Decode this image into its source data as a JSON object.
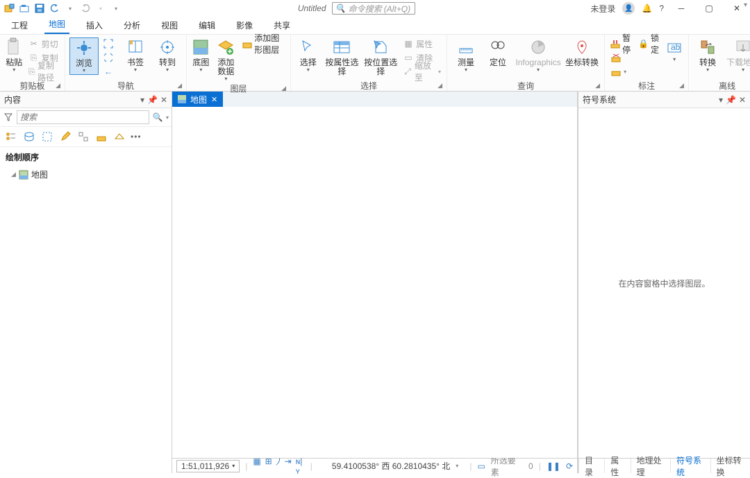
{
  "title": "Untitled",
  "search_placeholder": "命令搜索 (Alt+Q)",
  "login_status": "未登录",
  "ribbon_tabs": [
    "工程",
    "地图",
    "插入",
    "分析",
    "视图",
    "编辑",
    "影像",
    "共享"
  ],
  "active_tab_index": 1,
  "clipboard": {
    "paste": "粘贴",
    "cut": "剪切",
    "copy": "复制",
    "copy_path": "复制路径",
    "group": "剪贴板"
  },
  "nav": {
    "browse": "浏览",
    "bookmark": "书签",
    "goto": "转到",
    "group": "导航"
  },
  "layer": {
    "basemap": "底图",
    "add_data": "添加数据",
    "add_graphics": "添加图形图层",
    "group": "图层"
  },
  "select": {
    "select": "选择",
    "by_attr": "按属性选择",
    "by_loc": "按位置选择",
    "attr": "属性",
    "clear": "清除",
    "zoom": "缩放至",
    "group": "选择"
  },
  "query": {
    "measure": "测量",
    "locate": "定位",
    "info": "Infographics",
    "coord": "坐标转换",
    "group": "查询"
  },
  "annotate": {
    "pause": "暂停",
    "lock": "锁定",
    "more_tools": "更多注释工具",
    "group": "标注"
  },
  "offline": {
    "convert": "转换",
    "download": "下载地图",
    "group": "离线"
  },
  "contents": {
    "title": "内容",
    "search_ph": "搜索",
    "draw_order": "绘制顺序",
    "item": "地图"
  },
  "map_tab": "地图",
  "scale": "1:51,011,926",
  "coords": "59.4100538° 西 60.2810435° 北",
  "sel_label": "所选要素",
  "sel_count": "0",
  "symbol": {
    "title": "符号系统",
    "hint": "在内容窗格中选择图层。"
  },
  "side_tabs": [
    "目录",
    "属性",
    "地理处理",
    "符号系统",
    "坐标转换"
  ],
  "side_active_index": 3
}
